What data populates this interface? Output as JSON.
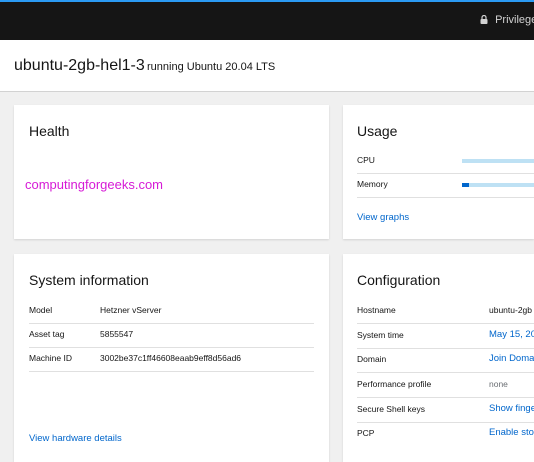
{
  "topbar": {
    "privileged_label": "Privileged"
  },
  "host": {
    "name": "ubuntu-2gb-hel1-3",
    "os_text": "running Ubuntu 20.04 LTS"
  },
  "health": {
    "title": "Health",
    "watermark": "computingforgeeks.com",
    "watermark_color": "#d61ad6"
  },
  "usage": {
    "title": "Usage",
    "cpu": {
      "label": "CPU",
      "fraction": 0.0
    },
    "memory": {
      "label": "Memory",
      "fraction": 0.1
    },
    "view_graphs": "View graphs"
  },
  "system_info": {
    "title": "System information",
    "rows": [
      {
        "label": "Model",
        "value": "Hetzner vServer"
      },
      {
        "label": "Asset tag",
        "value": "5855547"
      },
      {
        "label": "Machine ID",
        "value": "3002be37c1ff46608eaab9eff8d56ad6"
      }
    ],
    "view_details": "View hardware details"
  },
  "configuration": {
    "title": "Configuration",
    "rows": [
      {
        "label": "Hostname",
        "value": "ubuntu-2gb"
      },
      {
        "label": "System time",
        "value": "May 15, 20"
      },
      {
        "label": "Domain",
        "value": "Join Doma"
      },
      {
        "label": "Performance profile",
        "value": "none"
      },
      {
        "label": "Secure Shell keys",
        "value": "Show finge"
      },
      {
        "label": "PCP",
        "value": "Enable sto"
      }
    ]
  },
  "colors": {
    "accent": "#0066cc",
    "topbar": "#151515",
    "link": "#0066cc"
  }
}
